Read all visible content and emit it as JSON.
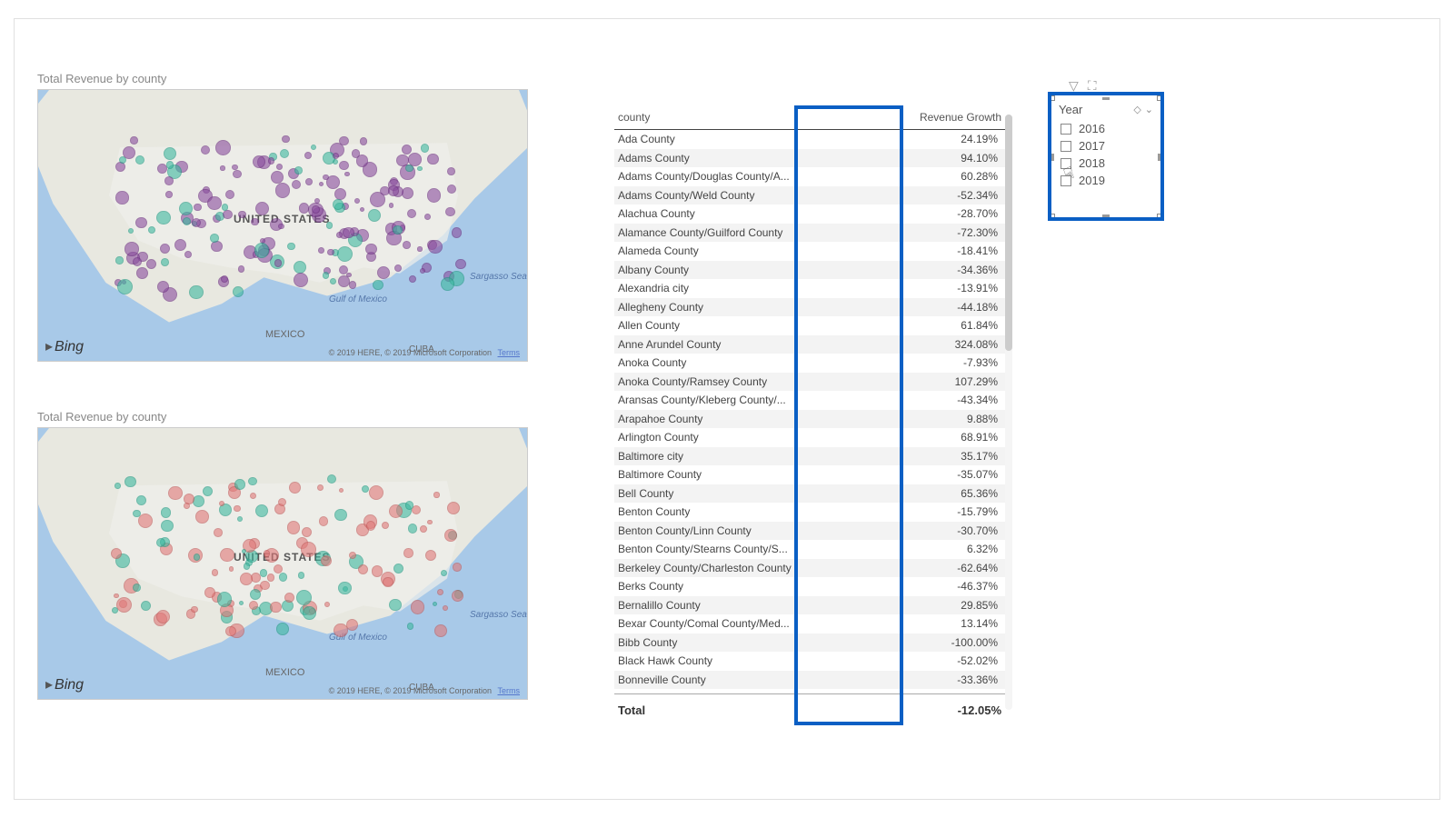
{
  "map1": {
    "title": "Total Revenue by county",
    "label_us": "UNITED STATES",
    "label_mexico": "MEXICO",
    "label_cuba": "CUBA",
    "label_sea": "Sargasso Sea",
    "label_gulf": "Gulf of\nMexico",
    "brand": "Bing",
    "attrib_text": "© 2019 HERE, © 2019 Microsoft Corporation",
    "attrib_link": "Terms"
  },
  "map2": {
    "title": "Total Revenue by county",
    "label_us": "UNITED STATES",
    "label_mexico": "MEXICO",
    "label_cuba": "CUBA",
    "label_sea": "Sargasso Sea",
    "label_gulf": "Gulf of\nMexico",
    "brand": "Bing",
    "attrib_text": "© 2019 HERE, © 2019 Microsoft Corporation",
    "attrib_link": "Terms"
  },
  "table": {
    "header_county": "county",
    "header_growth": "Revenue Growth",
    "total_label": "Total",
    "total_value": "-12.05%",
    "rows": [
      {
        "county": "Ada County",
        "growth": "24.19%"
      },
      {
        "county": "Adams County",
        "growth": "94.10%"
      },
      {
        "county": "Adams County/Douglas County/A...",
        "growth": "60.28%"
      },
      {
        "county": "Adams County/Weld County",
        "growth": "-52.34%"
      },
      {
        "county": "Alachua County",
        "growth": "-28.70%"
      },
      {
        "county": "Alamance County/Guilford County",
        "growth": "-72.30%"
      },
      {
        "county": "Alameda County",
        "growth": "-18.41%"
      },
      {
        "county": "Albany County",
        "growth": "-34.36%"
      },
      {
        "county": "Alexandria city",
        "growth": "-13.91%"
      },
      {
        "county": "Allegheny County",
        "growth": "-44.18%"
      },
      {
        "county": "Allen County",
        "growth": "61.84%"
      },
      {
        "county": "Anne Arundel County",
        "growth": "324.08%"
      },
      {
        "county": "Anoka County",
        "growth": "-7.93%"
      },
      {
        "county": "Anoka County/Ramsey County",
        "growth": "107.29%"
      },
      {
        "county": "Aransas County/Kleberg County/...",
        "growth": "-43.34%"
      },
      {
        "county": "Arapahoe County",
        "growth": "9.88%"
      },
      {
        "county": "Arlington County",
        "growth": "68.91%"
      },
      {
        "county": "Baltimore city",
        "growth": "35.17%"
      },
      {
        "county": "Baltimore County",
        "growth": "-35.07%"
      },
      {
        "county": "Bell County",
        "growth": "65.36%"
      },
      {
        "county": "Benton County",
        "growth": "-15.79%"
      },
      {
        "county": "Benton County/Linn County",
        "growth": "-30.70%"
      },
      {
        "county": "Benton County/Stearns County/S...",
        "growth": "6.32%"
      },
      {
        "county": "Berkeley County/Charleston County",
        "growth": "-62.64%"
      },
      {
        "county": "Berks County",
        "growth": "-46.37%"
      },
      {
        "county": "Bernalillo County",
        "growth": "29.85%"
      },
      {
        "county": "Bexar County/Comal County/Med...",
        "growth": "13.14%"
      },
      {
        "county": "Bibb County",
        "growth": "-100.00%"
      },
      {
        "county": "Black Hawk County",
        "growth": "-52.02%"
      },
      {
        "county": "Bonneville County",
        "growth": "-33.36%"
      }
    ]
  },
  "slicer": {
    "title": "Year",
    "items": [
      "2016",
      "2017",
      "2018",
      "2019"
    ]
  }
}
